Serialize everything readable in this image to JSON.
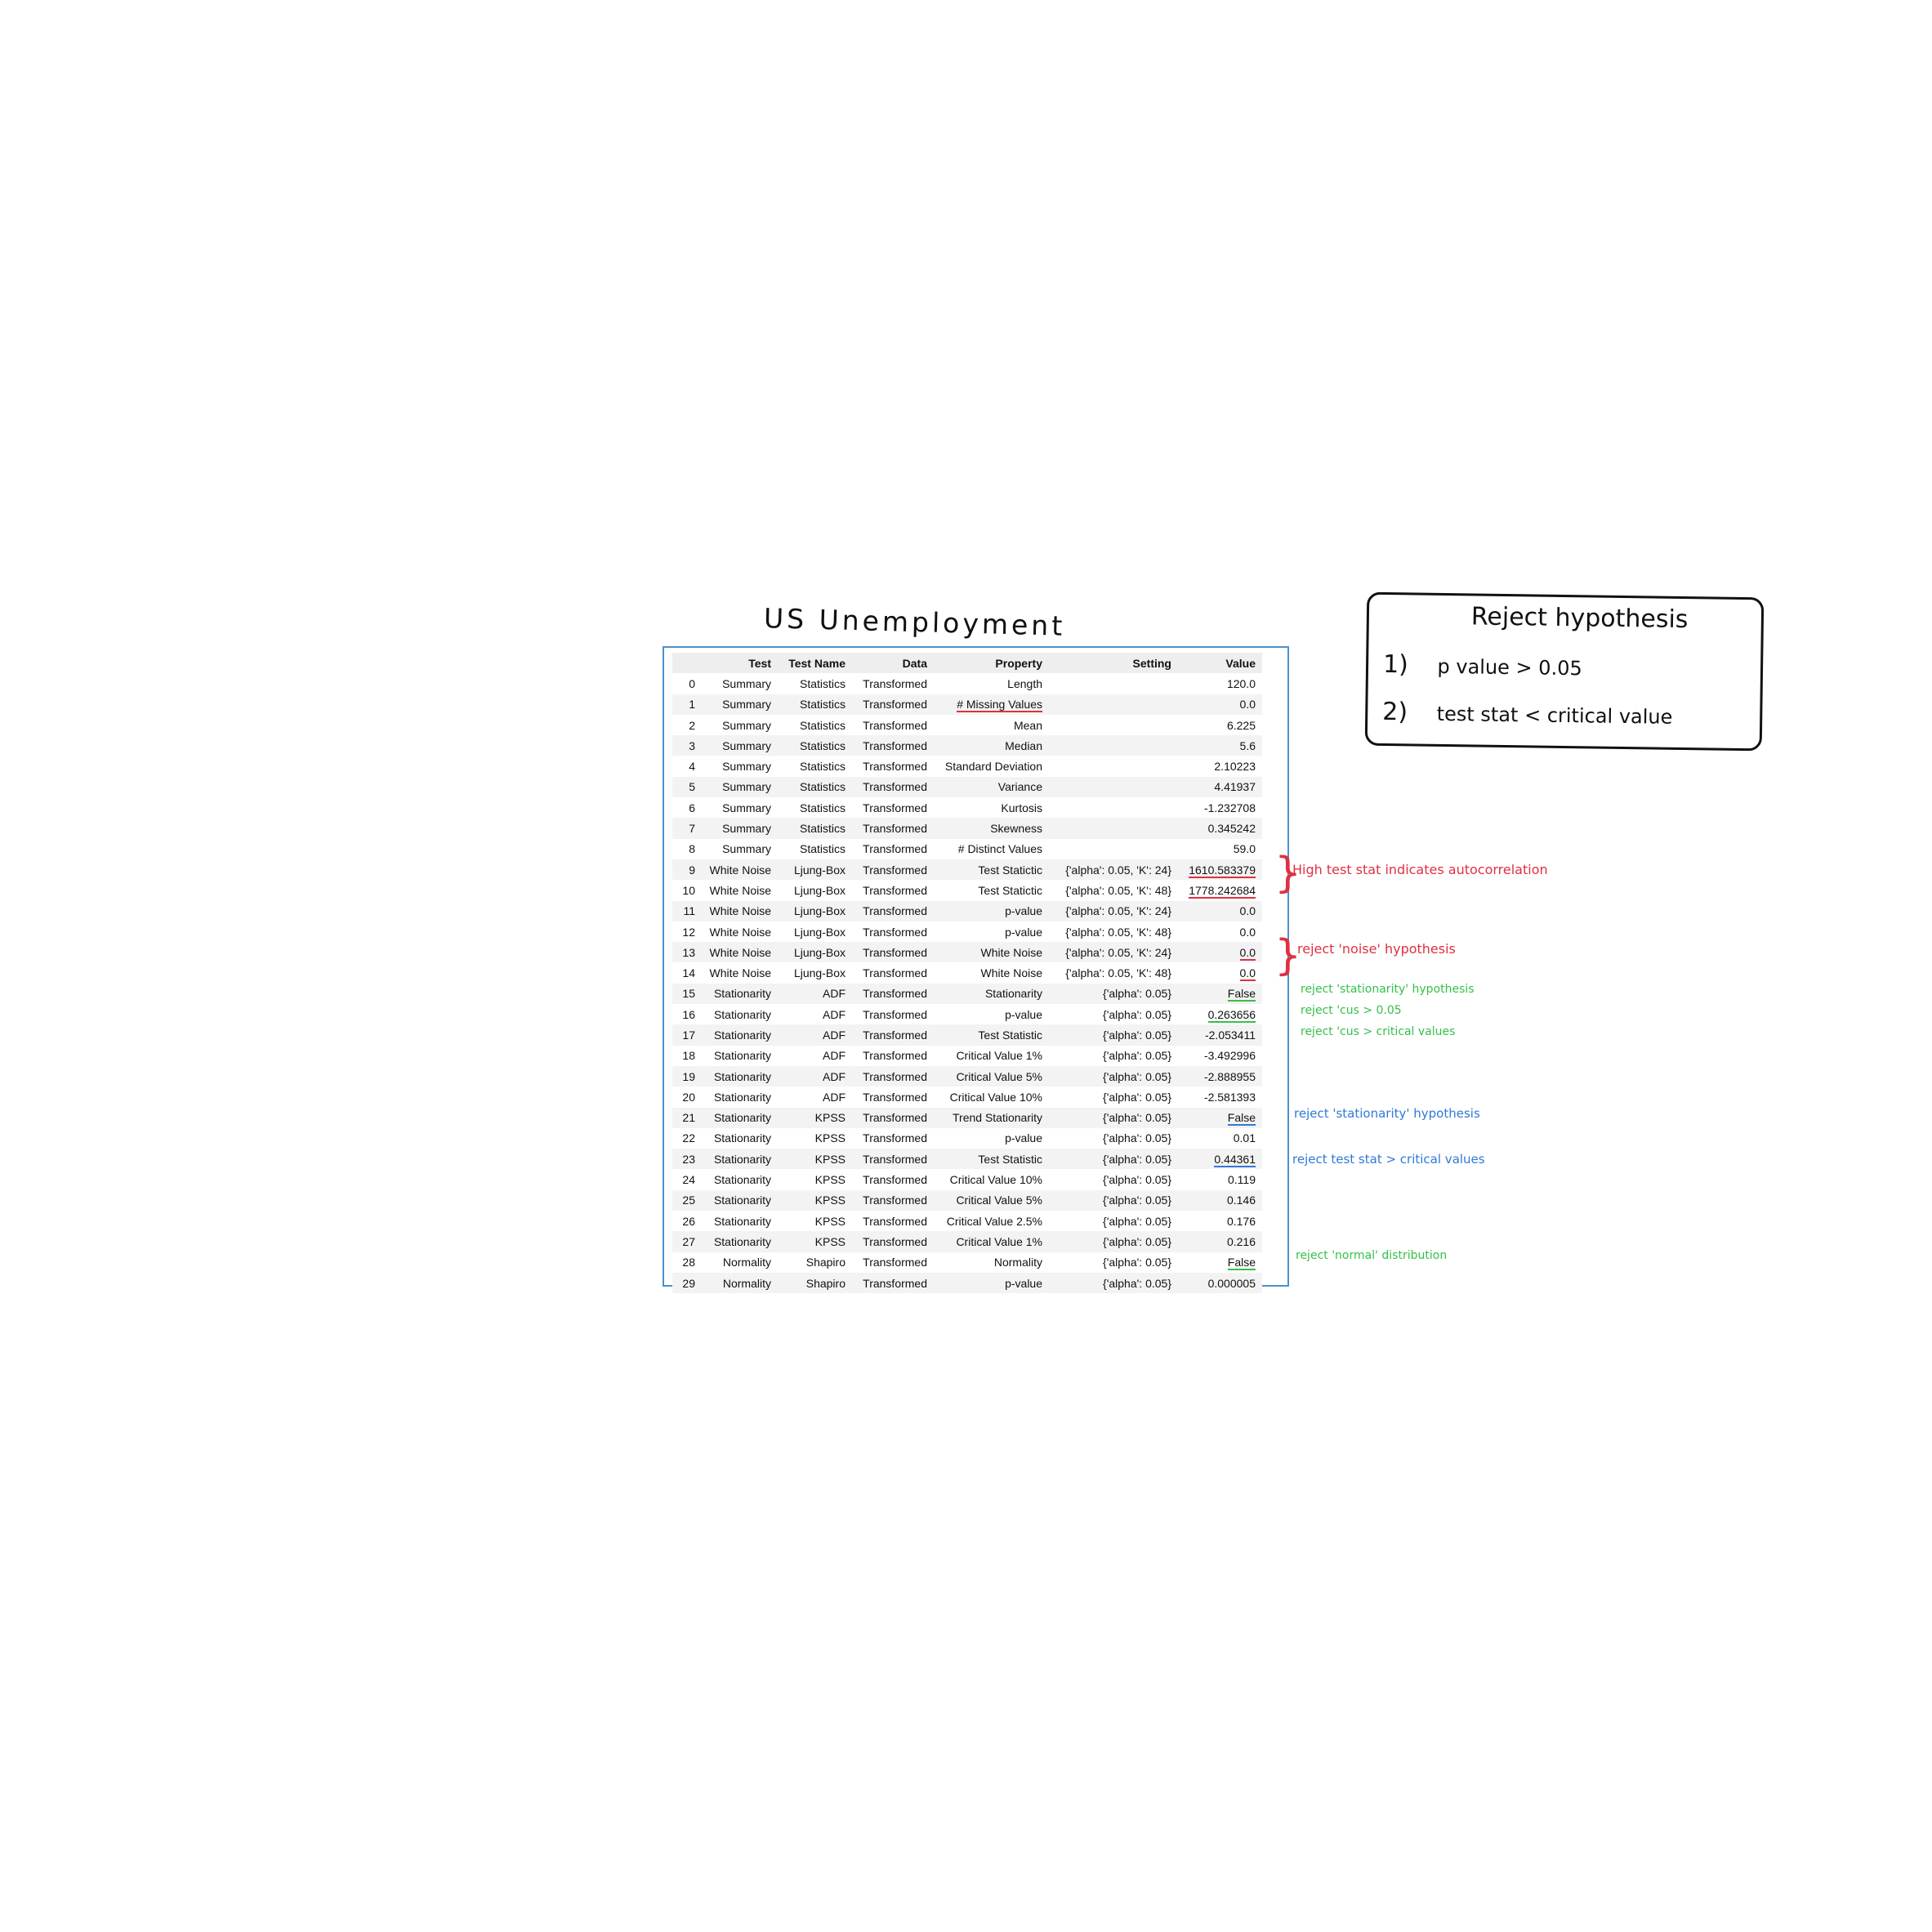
{
  "title": "US Unemployment",
  "table": {
    "headers": [
      "",
      "Test",
      "Test Name",
      "Data",
      "Property",
      "Setting",
      "Value"
    ],
    "rows": [
      [
        "0",
        "Summary",
        "Statistics",
        "Transformed",
        "Length",
        "",
        "120.0"
      ],
      [
        "1",
        "Summary",
        "Statistics",
        "Transformed",
        "# Missing Values",
        "",
        "0.0"
      ],
      [
        "2",
        "Summary",
        "Statistics",
        "Transformed",
        "Mean",
        "",
        "6.225"
      ],
      [
        "3",
        "Summary",
        "Statistics",
        "Transformed",
        "Median",
        "",
        "5.6"
      ],
      [
        "4",
        "Summary",
        "Statistics",
        "Transformed",
        "Standard Deviation",
        "",
        "2.10223"
      ],
      [
        "5",
        "Summary",
        "Statistics",
        "Transformed",
        "Variance",
        "",
        "4.41937"
      ],
      [
        "6",
        "Summary",
        "Statistics",
        "Transformed",
        "Kurtosis",
        "",
        "-1.232708"
      ],
      [
        "7",
        "Summary",
        "Statistics",
        "Transformed",
        "Skewness",
        "",
        "0.345242"
      ],
      [
        "8",
        "Summary",
        "Statistics",
        "Transformed",
        "# Distinct Values",
        "",
        "59.0"
      ],
      [
        "9",
        "White Noise",
        "Ljung-Box",
        "Transformed",
        "Test Statictic",
        "{'alpha': 0.05, 'K': 24}",
        "1610.583379"
      ],
      [
        "10",
        "White Noise",
        "Ljung-Box",
        "Transformed",
        "Test Statictic",
        "{'alpha': 0.05, 'K': 48}",
        "1778.242684"
      ],
      [
        "11",
        "White Noise",
        "Ljung-Box",
        "Transformed",
        "p-value",
        "{'alpha': 0.05, 'K': 24}",
        "0.0"
      ],
      [
        "12",
        "White Noise",
        "Ljung-Box",
        "Transformed",
        "p-value",
        "{'alpha': 0.05, 'K': 48}",
        "0.0"
      ],
      [
        "13",
        "White Noise",
        "Ljung-Box",
        "Transformed",
        "White Noise",
        "{'alpha': 0.05, 'K': 24}",
        "0.0"
      ],
      [
        "14",
        "White Noise",
        "Ljung-Box",
        "Transformed",
        "White Noise",
        "{'alpha': 0.05, 'K': 48}",
        "0.0"
      ],
      [
        "15",
        "Stationarity",
        "ADF",
        "Transformed",
        "Stationarity",
        "{'alpha': 0.05}",
        "False"
      ],
      [
        "16",
        "Stationarity",
        "ADF",
        "Transformed",
        "p-value",
        "{'alpha': 0.05}",
        "0.263656"
      ],
      [
        "17",
        "Stationarity",
        "ADF",
        "Transformed",
        "Test Statistic",
        "{'alpha': 0.05}",
        "-2.053411"
      ],
      [
        "18",
        "Stationarity",
        "ADF",
        "Transformed",
        "Critical Value 1%",
        "{'alpha': 0.05}",
        "-3.492996"
      ],
      [
        "19",
        "Stationarity",
        "ADF",
        "Transformed",
        "Critical Value 5%",
        "{'alpha': 0.05}",
        "-2.888955"
      ],
      [
        "20",
        "Stationarity",
        "ADF",
        "Transformed",
        "Critical Value 10%",
        "{'alpha': 0.05}",
        "-2.581393"
      ],
      [
        "21",
        "Stationarity",
        "KPSS",
        "Transformed",
        "Trend Stationarity",
        "{'alpha': 0.05}",
        "False"
      ],
      [
        "22",
        "Stationarity",
        "KPSS",
        "Transformed",
        "p-value",
        "{'alpha': 0.05}",
        "0.01"
      ],
      [
        "23",
        "Stationarity",
        "KPSS",
        "Transformed",
        "Test Statistic",
        "{'alpha': 0.05}",
        "0.44361"
      ],
      [
        "24",
        "Stationarity",
        "KPSS",
        "Transformed",
        "Critical Value 10%",
        "{'alpha': 0.05}",
        "0.119"
      ],
      [
        "25",
        "Stationarity",
        "KPSS",
        "Transformed",
        "Critical Value 5%",
        "{'alpha': 0.05}",
        "0.146"
      ],
      [
        "26",
        "Stationarity",
        "KPSS",
        "Transformed",
        "Critical Value 2.5%",
        "{'alpha': 0.05}",
        "0.176"
      ],
      [
        "27",
        "Stationarity",
        "KPSS",
        "Transformed",
        "Critical Value 1%",
        "{'alpha': 0.05}",
        "0.216"
      ],
      [
        "28",
        "Normality",
        "Shapiro",
        "Transformed",
        "Normality",
        "{'alpha': 0.05}",
        "False"
      ],
      [
        "29",
        "Normality",
        "Shapiro",
        "Transformed",
        "p-value",
        "{'alpha': 0.05}",
        "0.000005"
      ]
    ]
  },
  "hypothesis_box": {
    "title": "Reject hypothesis",
    "items": [
      {
        "num": "1)",
        "text": "p value > 0.05"
      },
      {
        "num": "2)",
        "text": "test stat < critical value"
      }
    ]
  },
  "annotations": {
    "high_test_stat": "High test stat indicates autocorrelation",
    "reject_noise": "reject 'noise' hypothesis",
    "reject_stationarity_green": "reject 'stationarity' hypothesis",
    "reject_pvalue": "reject 'cus > 0.05",
    "reject_critical_green": "reject 'cus > critical values",
    "reject_stationarity_blue": "reject 'stationarity' hypothesis",
    "reject_test_stat": "reject test stat > critical values",
    "reject_normal": "reject 'normal' distribution"
  },
  "colors": {
    "red": "#e03040",
    "green": "#36c04a",
    "blue": "#2f7ad6",
    "table_border": "#4f8fd0"
  }
}
